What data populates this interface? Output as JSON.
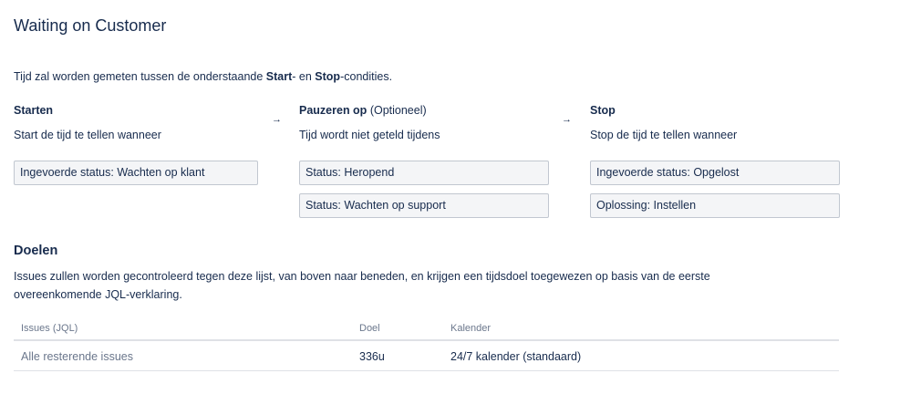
{
  "page": {
    "title": "Waiting on Customer",
    "description": {
      "prefix": "Tijd zal worden gemeten tussen de onderstaande ",
      "start_word": "Start",
      "middle": "- en ",
      "stop_word": "Stop",
      "suffix": "-condities."
    }
  },
  "conditions": {
    "start": {
      "heading": "Starten",
      "subtitle": "Start de tijd te tellen wanneer",
      "items": [
        "Ingevoerde status: Wachten op klant"
      ]
    },
    "pause": {
      "heading": "Pauzeren op",
      "optional": "(Optioneel)",
      "subtitle": "Tijd wordt niet geteld tijdens",
      "items": [
        "Status: Heropend",
        "Status: Wachten op support"
      ]
    },
    "stop": {
      "heading": "Stop",
      "subtitle": "Stop de tijd te tellen wanneer",
      "items": [
        "Ingevoerde status: Opgelost",
        "Oplossing: Instellen"
      ]
    },
    "arrow": "→"
  },
  "goals": {
    "title": "Doelen",
    "description": "Issues zullen worden gecontroleerd tegen deze lijst, van boven naar beneden, en krijgen een tijdsdoel toegewezen op basis van de eerste overeenkomende JQL-verklaring.",
    "columns": [
      "Issues (JQL)",
      "Doel",
      "Kalender"
    ],
    "rows": [
      {
        "issues": "Alle resterende issues",
        "goal": "336u",
        "calendar": "24/7 kalender (standaard)"
      }
    ]
  },
  "colors": {
    "text": "#172b4d",
    "muted": "#6b778c",
    "condition_bg": "#f4f5f7",
    "condition_border": "#c1c7d0",
    "divider": "#dfe1e6"
  }
}
